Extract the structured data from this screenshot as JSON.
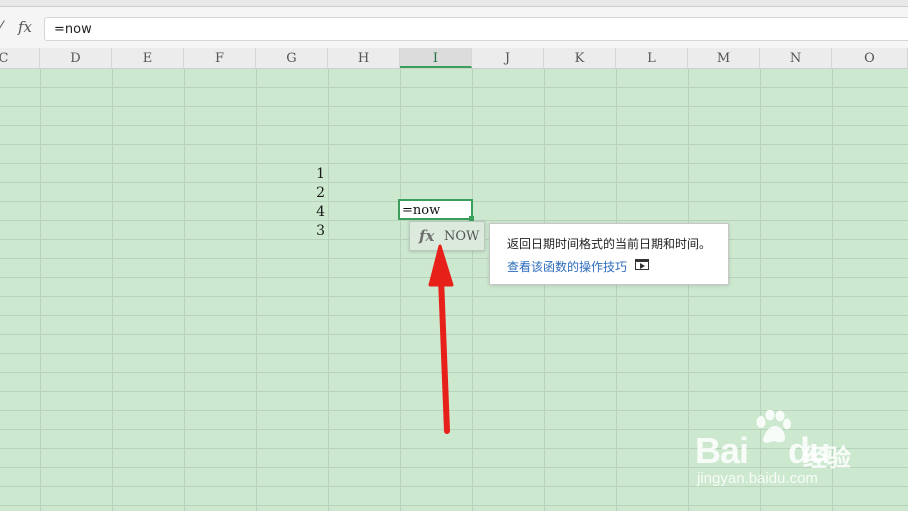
{
  "formula_bar": {
    "fx_label": "fx",
    "value": "=now"
  },
  "columns": [
    "C",
    "D",
    "E",
    "F",
    "G",
    "H",
    "I",
    "J",
    "K",
    "L",
    "M",
    "N",
    "O"
  ],
  "active_column": "I",
  "cells": [
    {
      "row": 1,
      "value": "1"
    },
    {
      "row": 2,
      "value": "2"
    },
    {
      "row": 3,
      "value": "4"
    },
    {
      "row": 4,
      "value": "3"
    }
  ],
  "active_cell": {
    "value": "=now"
  },
  "autocomplete": {
    "icon": "fx-icon",
    "fx_label": "fx",
    "function_name": "NOW"
  },
  "tooltip": {
    "description": "返回日期时间格式的当前日期和时间。",
    "link_text": "查看该函数的操作技巧",
    "link_icon": "video-play-icon"
  },
  "watermark": {
    "brand": "Bai",
    "brand2": "du",
    "cn": "经验",
    "url": "jingyan.baidu.com"
  },
  "colors": {
    "grid_background": "#cce8cf",
    "active_border": "#3a9f5a",
    "link": "#2d6cbd",
    "annotation_arrow": "#e8201a"
  }
}
